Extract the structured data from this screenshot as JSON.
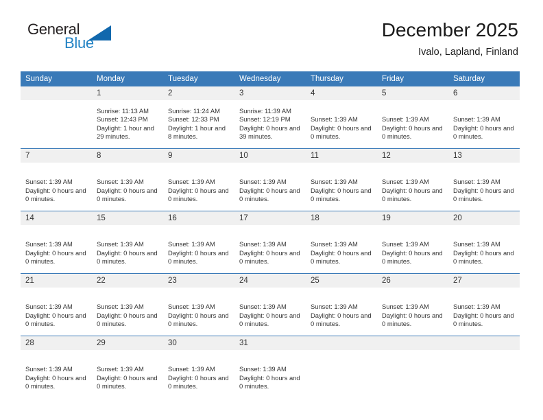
{
  "brand": {
    "name_part1": "General",
    "name_part2": "Blue",
    "logo_icon": "triangle-icon"
  },
  "header": {
    "title": "December 2025",
    "subtitle": "Ivalo, Lapland, Finland"
  },
  "calendar": {
    "weekday_headers": [
      "Sunday",
      "Monday",
      "Tuesday",
      "Wednesday",
      "Thursday",
      "Friday",
      "Saturday"
    ],
    "accent_color": "#3a7ab8",
    "band_color": "#f0f0f0",
    "weeks": [
      [
        {
          "day": "",
          "lines": []
        },
        {
          "day": "1",
          "lines": [
            "Sunrise: 11:13 AM",
            "Sunset: 12:43 PM",
            "Daylight: 1 hour and 29 minutes."
          ]
        },
        {
          "day": "2",
          "lines": [
            "Sunrise: 11:24 AM",
            "Sunset: 12:33 PM",
            "Daylight: 1 hour and 8 minutes."
          ]
        },
        {
          "day": "3",
          "lines": [
            "Sunrise: 11:39 AM",
            "Sunset: 12:19 PM",
            "Daylight: 0 hours and 39 minutes."
          ]
        },
        {
          "day": "4",
          "lines": [
            "",
            "Sunset: 1:39 AM",
            "Daylight: 0 hours and 0 minutes."
          ]
        },
        {
          "day": "5",
          "lines": [
            "",
            "Sunset: 1:39 AM",
            "Daylight: 0 hours and 0 minutes."
          ]
        },
        {
          "day": "6",
          "lines": [
            "",
            "Sunset: 1:39 AM",
            "Daylight: 0 hours and 0 minutes."
          ]
        }
      ],
      [
        {
          "day": "7",
          "lines": [
            "",
            "Sunset: 1:39 AM",
            "Daylight: 0 hours and 0 minutes."
          ]
        },
        {
          "day": "8",
          "lines": [
            "",
            "Sunset: 1:39 AM",
            "Daylight: 0 hours and 0 minutes."
          ]
        },
        {
          "day": "9",
          "lines": [
            "",
            "Sunset: 1:39 AM",
            "Daylight: 0 hours and 0 minutes."
          ]
        },
        {
          "day": "10",
          "lines": [
            "",
            "Sunset: 1:39 AM",
            "Daylight: 0 hours and 0 minutes."
          ]
        },
        {
          "day": "11",
          "lines": [
            "",
            "Sunset: 1:39 AM",
            "Daylight: 0 hours and 0 minutes."
          ]
        },
        {
          "day": "12",
          "lines": [
            "",
            "Sunset: 1:39 AM",
            "Daylight: 0 hours and 0 minutes."
          ]
        },
        {
          "day": "13",
          "lines": [
            "",
            "Sunset: 1:39 AM",
            "Daylight: 0 hours and 0 minutes."
          ]
        }
      ],
      [
        {
          "day": "14",
          "lines": [
            "",
            "Sunset: 1:39 AM",
            "Daylight: 0 hours and 0 minutes."
          ]
        },
        {
          "day": "15",
          "lines": [
            "",
            "Sunset: 1:39 AM",
            "Daylight: 0 hours and 0 minutes."
          ]
        },
        {
          "day": "16",
          "lines": [
            "",
            "Sunset: 1:39 AM",
            "Daylight: 0 hours and 0 minutes."
          ]
        },
        {
          "day": "17",
          "lines": [
            "",
            "Sunset: 1:39 AM",
            "Daylight: 0 hours and 0 minutes."
          ]
        },
        {
          "day": "18",
          "lines": [
            "",
            "Sunset: 1:39 AM",
            "Daylight: 0 hours and 0 minutes."
          ]
        },
        {
          "day": "19",
          "lines": [
            "",
            "Sunset: 1:39 AM",
            "Daylight: 0 hours and 0 minutes."
          ]
        },
        {
          "day": "20",
          "lines": [
            "",
            "Sunset: 1:39 AM",
            "Daylight: 0 hours and 0 minutes."
          ]
        }
      ],
      [
        {
          "day": "21",
          "lines": [
            "",
            "Sunset: 1:39 AM",
            "Daylight: 0 hours and 0 minutes."
          ]
        },
        {
          "day": "22",
          "lines": [
            "",
            "Sunset: 1:39 AM",
            "Daylight: 0 hours and 0 minutes."
          ]
        },
        {
          "day": "23",
          "lines": [
            "",
            "Sunset: 1:39 AM",
            "Daylight: 0 hours and 0 minutes."
          ]
        },
        {
          "day": "24",
          "lines": [
            "",
            "Sunset: 1:39 AM",
            "Daylight: 0 hours and 0 minutes."
          ]
        },
        {
          "day": "25",
          "lines": [
            "",
            "Sunset: 1:39 AM",
            "Daylight: 0 hours and 0 minutes."
          ]
        },
        {
          "day": "26",
          "lines": [
            "",
            "Sunset: 1:39 AM",
            "Daylight: 0 hours and 0 minutes."
          ]
        },
        {
          "day": "27",
          "lines": [
            "",
            "Sunset: 1:39 AM",
            "Daylight: 0 hours and 0 minutes."
          ]
        }
      ],
      [
        {
          "day": "28",
          "lines": [
            "",
            "Sunset: 1:39 AM",
            "Daylight: 0 hours and 0 minutes."
          ]
        },
        {
          "day": "29",
          "lines": [
            "",
            "Sunset: 1:39 AM",
            "Daylight: 0 hours and 0 minutes."
          ]
        },
        {
          "day": "30",
          "lines": [
            "",
            "Sunset: 1:39 AM",
            "Daylight: 0 hours and 0 minutes."
          ]
        },
        {
          "day": "31",
          "lines": [
            "",
            "Sunset: 1:39 AM",
            "Daylight: 0 hours and 0 minutes."
          ]
        },
        {
          "day": "",
          "lines": []
        },
        {
          "day": "",
          "lines": []
        },
        {
          "day": "",
          "lines": []
        }
      ]
    ]
  }
}
